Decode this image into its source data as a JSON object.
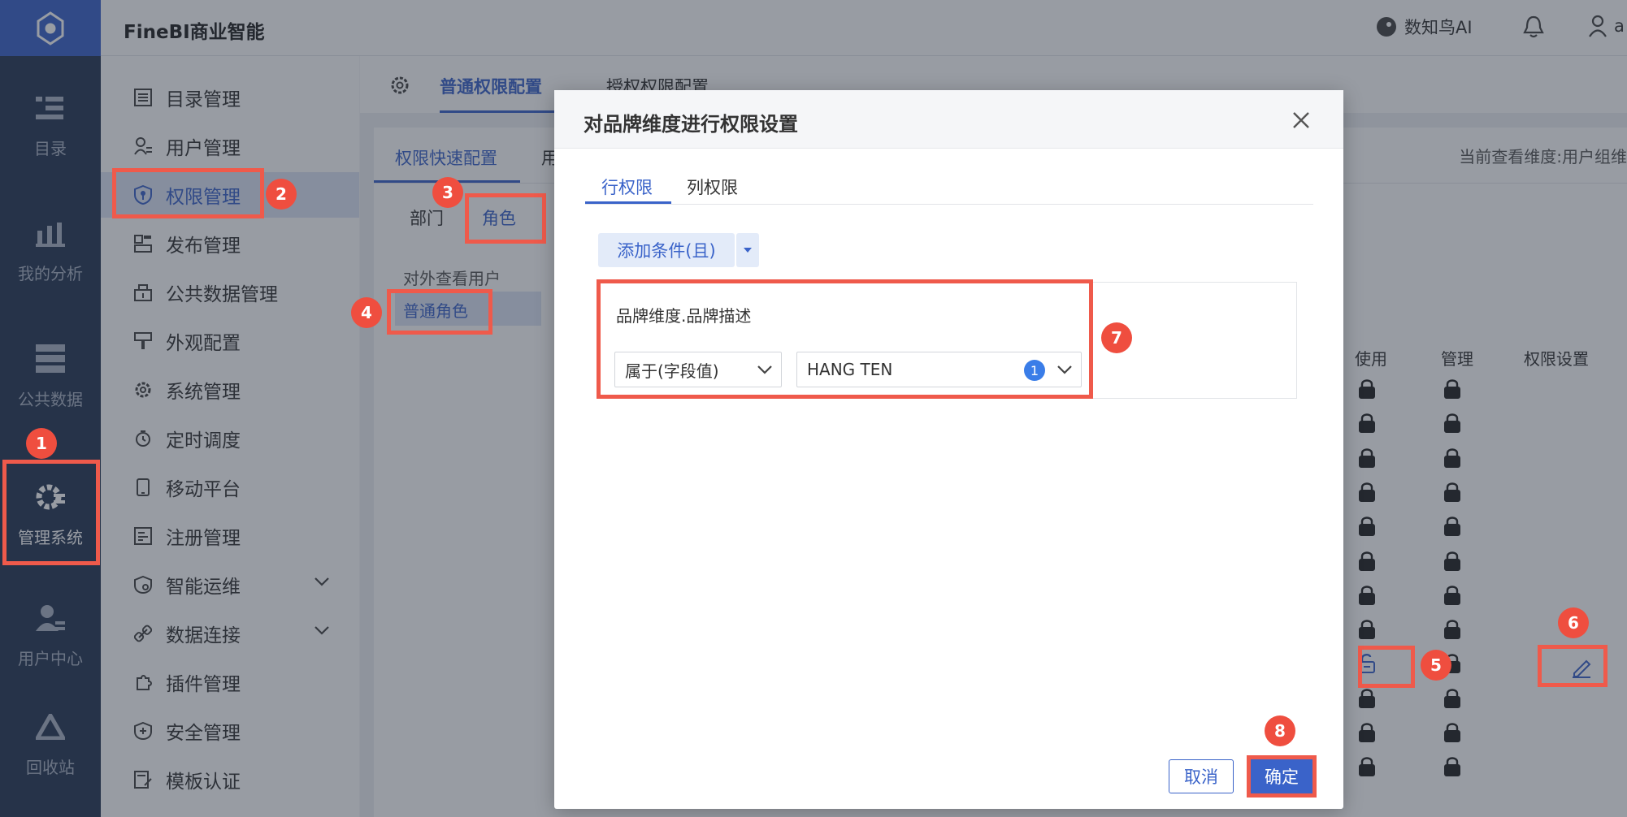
{
  "app": {
    "title": "FineBI商业智能",
    "ai_label": "数知鸟AI",
    "user_initial": "a"
  },
  "rail": [
    {
      "label": "目录",
      "icon": "catalog-icon"
    },
    {
      "label": "我的分析",
      "icon": "analysis-icon"
    },
    {
      "label": "公共数据",
      "icon": "public-data-icon"
    },
    {
      "label": "管理系统",
      "icon": "admin-gear-icon"
    },
    {
      "label": "用户中心",
      "icon": "user-center-icon"
    },
    {
      "label": "回收站",
      "icon": "recycle-icon"
    }
  ],
  "menu": [
    {
      "label": "目录管理",
      "icon": "list-icon"
    },
    {
      "label": "用户管理",
      "icon": "user-manage-icon"
    },
    {
      "label": "权限管理",
      "icon": "shield-key-icon"
    },
    {
      "label": "发布管理",
      "icon": "publish-icon"
    },
    {
      "label": "公共数据管理",
      "icon": "public-data-manage-icon"
    },
    {
      "label": "外观配置",
      "icon": "brush-icon"
    },
    {
      "label": "系统管理",
      "icon": "settings-icon"
    },
    {
      "label": "定时调度",
      "icon": "timer-icon"
    },
    {
      "label": "移动平台",
      "icon": "mobile-icon"
    },
    {
      "label": "注册管理",
      "icon": "register-icon"
    },
    {
      "label": "智能运维",
      "icon": "ops-icon"
    },
    {
      "label": "数据连接",
      "icon": "link-icon"
    },
    {
      "label": "插件管理",
      "icon": "plugin-icon"
    },
    {
      "label": "安全管理",
      "icon": "security-icon"
    },
    {
      "label": "模板认证",
      "icon": "template-icon"
    }
  ],
  "content": {
    "tabs": [
      "普通权限配置",
      "授权权限配置"
    ],
    "subtabs": [
      "权限快速配置",
      "用"
    ],
    "scope_label": "当前查看维度:用户组维",
    "dim_tabs": [
      "部门",
      "角色"
    ],
    "roles": [
      "对外查看用户",
      "普通角色"
    ],
    "table_headers": [
      "使用",
      "管理",
      "权限设置"
    ],
    "row_count": 12,
    "unlocked_row": 8
  },
  "dialog": {
    "title": "对品牌维度进行权限设置",
    "tabs": [
      "行权限",
      "列权限"
    ],
    "add_condition": "添加条件(且)",
    "field_name": "品牌维度.品牌描述",
    "operator": "属于(字段值)",
    "value": "HANG TEN",
    "value_count": "1",
    "cancel": "取消",
    "confirm": "确定"
  },
  "annotations": [
    "1",
    "2",
    "3",
    "4",
    "5",
    "6",
    "7",
    "8"
  ],
  "colors": {
    "accent": "#3a63c9",
    "annotation": "#ef5a4b",
    "rail": "#263753"
  }
}
